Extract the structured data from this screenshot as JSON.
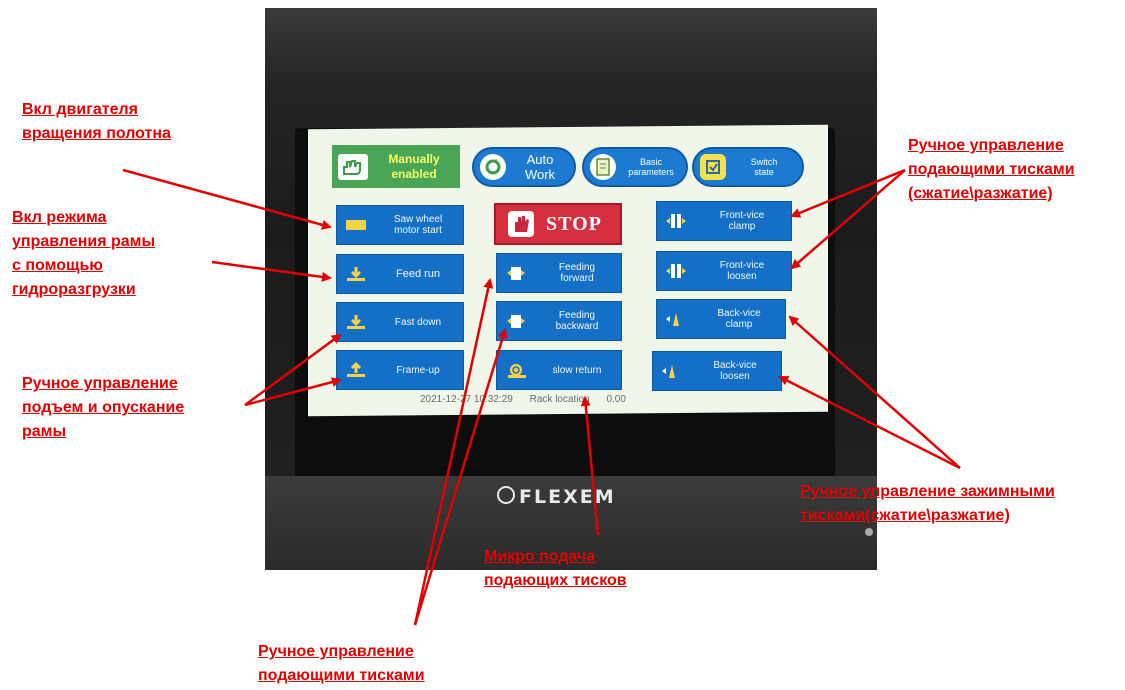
{
  "device": {
    "brand": "FLEXEM"
  },
  "screen": {
    "header": {
      "manual_label": "Manually\nenabled",
      "auto_label": "Auto\nWork",
      "basic_label": "Basic\nparameters",
      "switch_label": "Switch\nstate"
    },
    "left_column": [
      {
        "label": "Saw wheel\nmotor start"
      },
      {
        "label": "Feed run"
      },
      {
        "label": "Fast down"
      },
      {
        "label": "Frame-up"
      }
    ],
    "middle_column": {
      "stop_label": "STOP",
      "feeding_forward": "Feeding\nforward",
      "feeding_backward": "Feeding\nbackward",
      "slow_return": "slow return"
    },
    "right_column": [
      {
        "label": "Front-vice\nclamp"
      },
      {
        "label": "Front-vice\nloosen"
      },
      {
        "label": "Back-vice\nclamp"
      },
      {
        "label": "Back-vice\nloosen"
      }
    ],
    "status": {
      "datetime": "2021-12-27 10:32:29",
      "location": "Rack location",
      "value": "0.00"
    }
  },
  "annotations": {
    "saw_motor": "Вкл двигателя\nвращения полотна",
    "frame_mode": "Вкл режима\nуправления рамы\nс помощью\nгидроразгрузки",
    "frame_manual": "Ручное управление\nподъем и опускание\nрамы",
    "feed_vices": "Ручное управление\nподающими тисками\n(сжатие\\разжатие)",
    "clamp_vices": "Ручное управление зажимными\nтисками(сжатие\\разжатие)",
    "micro_feed": "Микро подача\nподающих тисков",
    "feed_manual": "Ручное управление\nподающими тисками"
  },
  "colors": {
    "annotation": "#e00000",
    "tile": "#1370c6",
    "manual": "#4ba556",
    "stop": "#d63040"
  },
  "icons": [
    "hand-icon",
    "refresh-icon",
    "document-icon",
    "switch-icon",
    "saw-icon",
    "arrow-down-icon",
    "arrow-up-icon",
    "stop-hand-icon",
    "feed-icon",
    "snail-icon",
    "vice-icon"
  ]
}
